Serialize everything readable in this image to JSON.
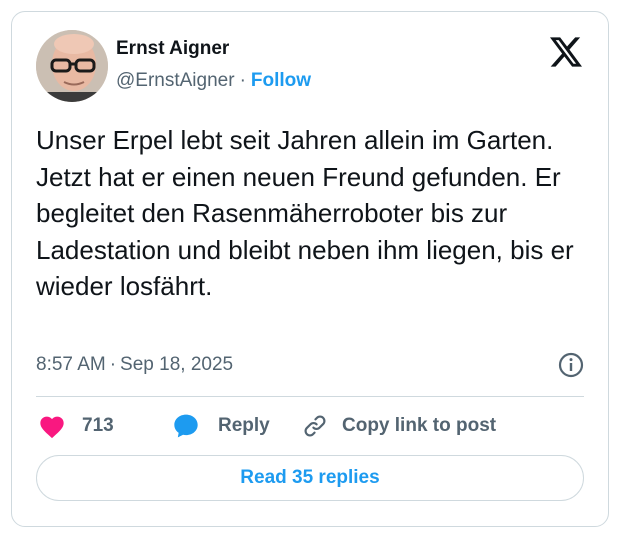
{
  "author": {
    "name": "Ernst Aigner",
    "handle": "@ErnstAigner",
    "separator": "·",
    "follow_label": "Follow"
  },
  "tweet": {
    "text": "Unser Erpel lebt seit Jahren allein im Garten. Jetzt hat er einen neuen Freund gefunden. Er begleitet den Rasenmäherroboter bis zur Ladestation und bleibt neben ihm liegen, bis er wieder losfährt.",
    "time": "8:57 AM",
    "separator": "·",
    "date": "Sep 18, 2025"
  },
  "actions": {
    "like_count": "713",
    "reply_label": "Reply",
    "copy_link_label": "Copy link to post"
  },
  "read_replies_label": "Read 35 replies",
  "icons": {
    "logo": "x-logo-icon",
    "info": "info-icon",
    "like": "heart-icon",
    "reply": "speech-bubble-icon",
    "copy": "link-icon"
  },
  "colors": {
    "accent": "#1d9bf0",
    "like": "#f91880",
    "muted": "#536471",
    "text": "#0f1419",
    "border": "#cfd9de"
  }
}
